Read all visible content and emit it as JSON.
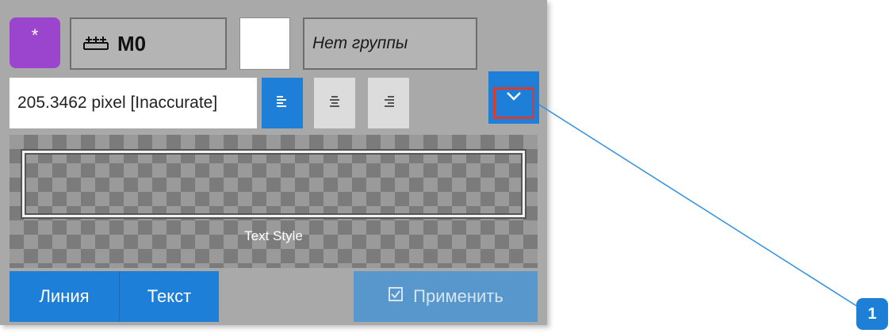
{
  "toolbar": {
    "star_button_label": "*",
    "layer_icon": "ruler-icon",
    "layer_name": "M0",
    "color_value": "#ffffff",
    "group_label": "Нет группы"
  },
  "text_settings": {
    "size_value": "205.3462 pixel [Inaccurate]",
    "align_left_icon": "align-left-icon",
    "align_center_icon": "align-center-icon",
    "align_right_icon": "align-right-icon",
    "dropdown_icon": "chevron-down-icon"
  },
  "preview": {
    "label": "Text Style"
  },
  "footer": {
    "line_label": "Линия",
    "text_label": "Текст",
    "apply_label": "Применить",
    "apply_icon": "checkbox-icon"
  },
  "callout": {
    "number": "1"
  },
  "colors": {
    "accent": "#1d7fd7",
    "star_button": "#9b45cf",
    "highlight": "#d63c2f",
    "panel": "#a9a9a9"
  }
}
